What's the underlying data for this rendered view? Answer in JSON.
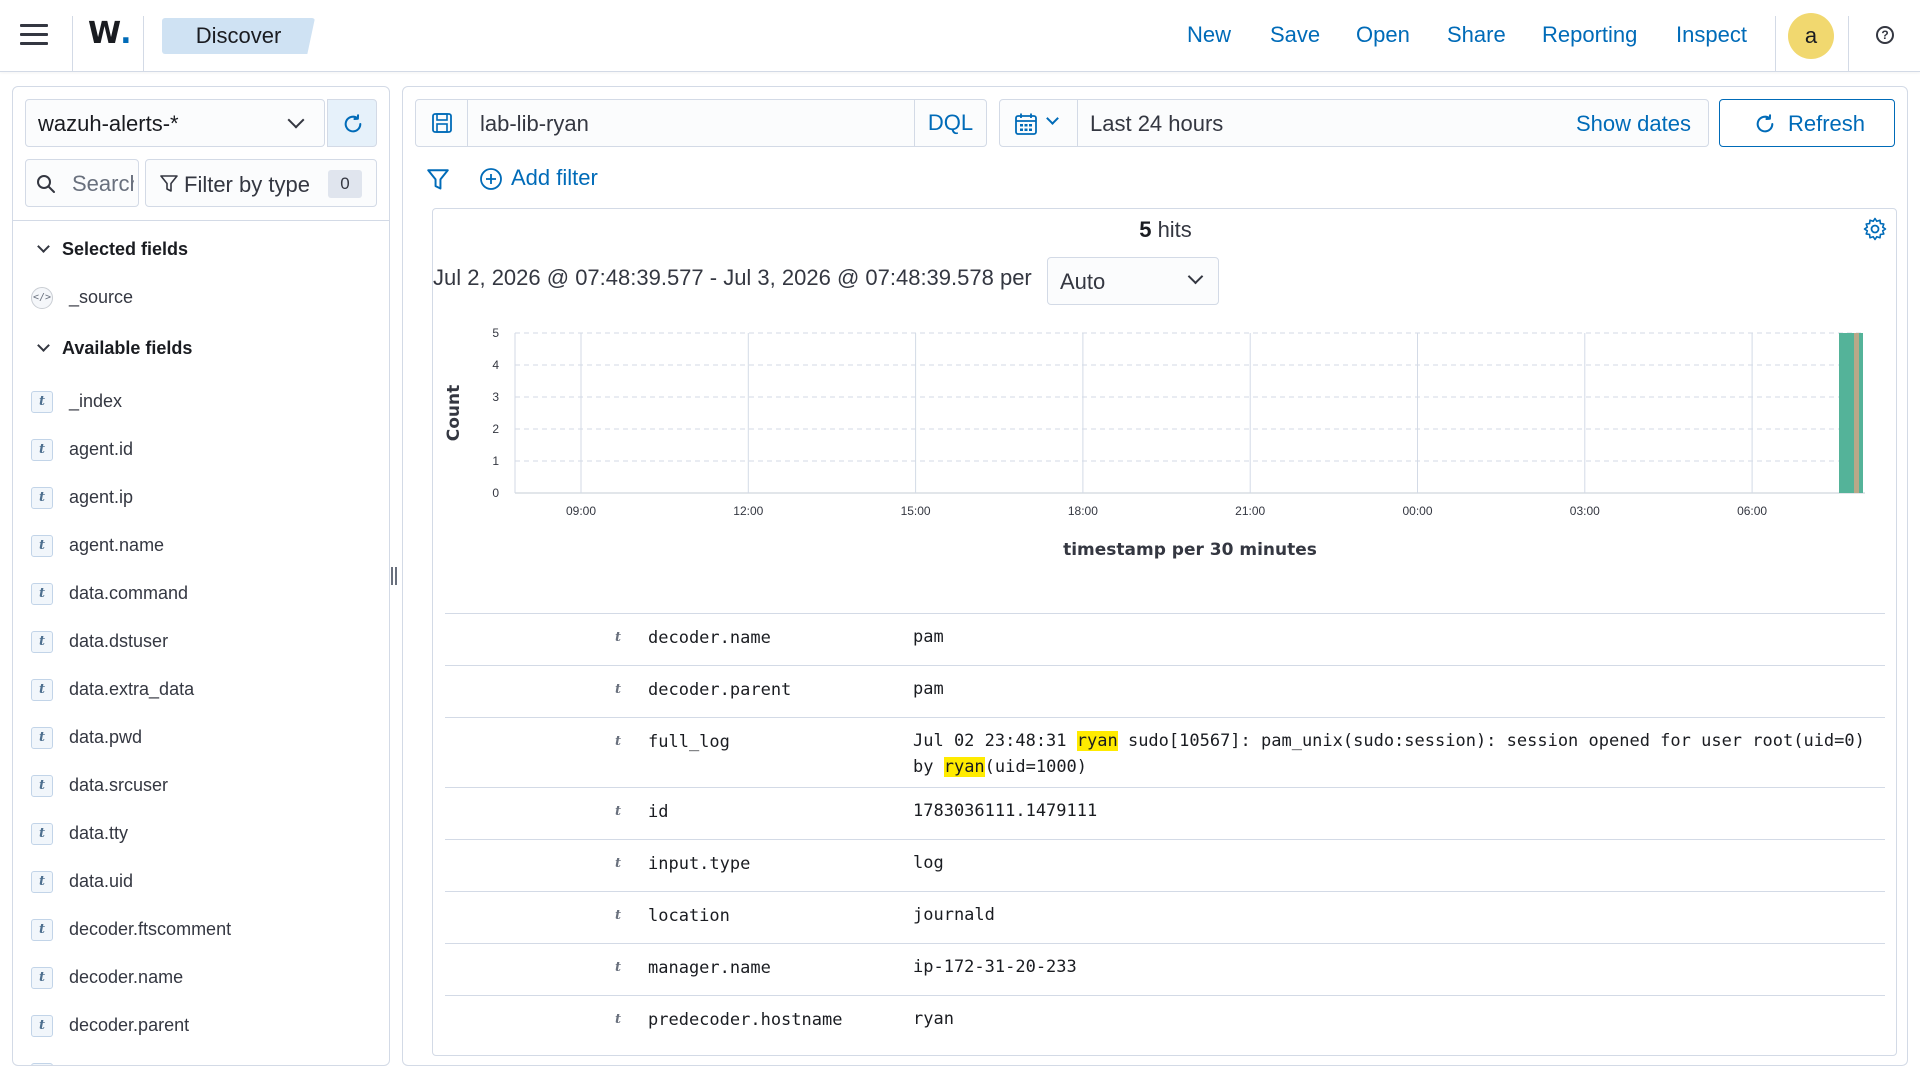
{
  "header": {
    "logo": "W",
    "breadcrumb": "Discover",
    "nav": [
      "New",
      "Save",
      "Open",
      "Share",
      "Reporting",
      "Inspect"
    ],
    "avatar_initial": "a",
    "help_icon": "?"
  },
  "sidebar": {
    "index_pattern": "wazuh-alerts-*",
    "search_placeholder": "Search field names",
    "filter_by_type_label": "Filter by type",
    "filter_count": "0",
    "selected_fields_label": "Selected fields",
    "selected_fields": [
      "_source"
    ],
    "available_fields_label": "Available fields",
    "available_fields": [
      "_index",
      "agent.id",
      "agent.ip",
      "agent.name",
      "data.command",
      "data.dstuser",
      "data.extra_data",
      "data.pwd",
      "data.srcuser",
      "data.tty",
      "data.uid",
      "decoder.ftscomment",
      "decoder.name",
      "decoder.parent"
    ]
  },
  "query": {
    "text": "lab-lib-ryan",
    "language": "DQL"
  },
  "time": {
    "range": "Last 24 hours",
    "show_dates": "Show dates",
    "refresh_label": "Refresh"
  },
  "filters": {
    "add_filter": "Add filter"
  },
  "results": {
    "hits_count": "5",
    "hits_label": "hits",
    "range_text": "Jul 2, 2026 @ 07:48:39.577 - Jul 3, 2026 @ 07:48:39.578 per",
    "interval": "Auto"
  },
  "chart_data": {
    "type": "bar",
    "xlabel": "timestamp per 30 minutes",
    "ylabel": "Count",
    "ylim": [
      0,
      5
    ],
    "y_ticks": [
      "0",
      "1",
      "2",
      "3",
      "4",
      "5"
    ],
    "x_ticks": [
      "09:00",
      "12:00",
      "15:00",
      "18:00",
      "21:00",
      "00:00",
      "03:00",
      "06:00"
    ],
    "series": [
      {
        "values": [
          5
        ],
        "color": "#54b399"
      },
      {
        "values": [
          5
        ],
        "color": "#b9a888"
      }
    ],
    "bar_label": "07:30",
    "grid": true
  },
  "document": {
    "rows": [
      {
        "type": "t",
        "key": "decoder.name",
        "segments": [
          {
            "text": "pam"
          }
        ]
      },
      {
        "type": "t",
        "key": "decoder.parent",
        "segments": [
          {
            "text": "pam"
          }
        ]
      },
      {
        "type": "t",
        "key": "full_log",
        "segments": [
          {
            "text": "Jul 02 23:48:31 "
          },
          {
            "text": "ryan",
            "hl": true
          },
          {
            "text": " sudo[10567]: pam_unix(sudo:session): session opened for user root(uid=0) by "
          },
          {
            "text": "ryan",
            "hl": true
          },
          {
            "text": "(uid=1000)"
          }
        ]
      },
      {
        "type": "t",
        "key": "id",
        "segments": [
          {
            "text": "1783036111.1479111"
          }
        ]
      },
      {
        "type": "t",
        "key": "input.type",
        "segments": [
          {
            "text": "log"
          }
        ]
      },
      {
        "type": "t",
        "key": "location",
        "segments": [
          {
            "text": "journald"
          }
        ]
      },
      {
        "type": "t",
        "key": "manager.name",
        "segments": [
          {
            "text": "ip-172-31-20-233"
          }
        ]
      },
      {
        "type": "t",
        "key": "predecoder.hostname",
        "segments": [
          {
            "text": "ryan"
          }
        ]
      }
    ]
  }
}
